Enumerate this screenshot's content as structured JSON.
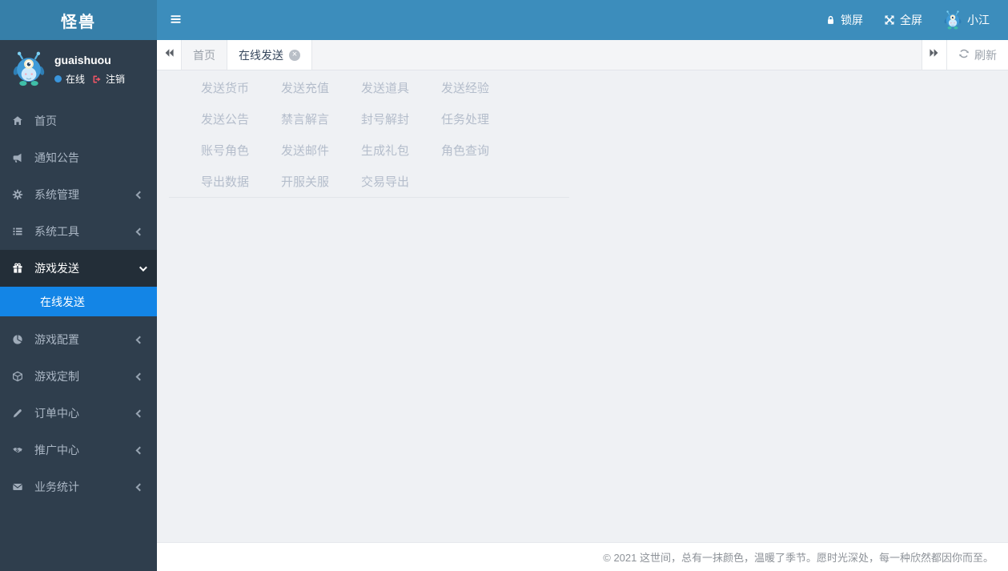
{
  "app": {
    "title": "怪兽"
  },
  "navbar": {
    "lock_label": "锁屏",
    "fullscreen_label": "全屏",
    "user_name": "小江"
  },
  "sidebar": {
    "user": {
      "name": "guaishuou",
      "status": "在线",
      "logout": "注销"
    },
    "items": [
      {
        "label": "首页",
        "icon": "home-icon",
        "expandable": false,
        "active": false
      },
      {
        "label": "通知公告",
        "icon": "bullhorn-icon",
        "expandable": false,
        "active": false
      },
      {
        "label": "系统管理",
        "icon": "gear-icon",
        "expandable": true,
        "active": false
      },
      {
        "label": "系统工具",
        "icon": "list-icon",
        "expandable": true,
        "active": false
      },
      {
        "label": "游戏发送",
        "icon": "gift-icon",
        "expandable": true,
        "active": true,
        "expanded": true,
        "children": [
          {
            "label": "在线发送",
            "active": true
          }
        ]
      },
      {
        "label": "游戏配置",
        "icon": "pie-chart-icon",
        "expandable": true,
        "active": false
      },
      {
        "label": "游戏定制",
        "icon": "cube-icon",
        "expandable": true,
        "active": false
      },
      {
        "label": "订单中心",
        "icon": "pencil-icon",
        "expandable": true,
        "active": false
      },
      {
        "label": "推广中心",
        "icon": "handshake-icon",
        "expandable": true,
        "active": false
      },
      {
        "label": "业务统计",
        "icon": "envelope-icon",
        "expandable": true,
        "active": false
      }
    ]
  },
  "tabs": {
    "items": [
      {
        "label": "首页",
        "active": false,
        "closable": false
      },
      {
        "label": "在线发送",
        "active": true,
        "closable": true
      }
    ],
    "refresh_label": "刷新"
  },
  "content": {
    "links": [
      [
        "发送货币",
        "发送充值",
        "发送道具",
        "发送经验"
      ],
      [
        "发送公告",
        "禁言解言",
        "封号解封",
        "任务处理"
      ],
      [
        "账号角色",
        "发送邮件",
        "生成礼包",
        "角色查询"
      ],
      [
        "导出数据",
        "开服关服",
        "交易导出"
      ]
    ]
  },
  "footer": {
    "text": "© 2021 这世间，总有一抹颜色，温暖了季节。愿时光深处，每一种欣然都因你而至。"
  },
  "colors": {
    "navbar": "#3c8dbc",
    "logo-bg": "#367fa9",
    "sidebar": "#2f3e4d",
    "sidebar-active": "#232e38",
    "submenu-active": "#1385e6",
    "logout-red": "#ed5565",
    "online-dot": "#3a96dd",
    "content-bg": "#eff1f4",
    "link-text": "#b4bdcb"
  }
}
